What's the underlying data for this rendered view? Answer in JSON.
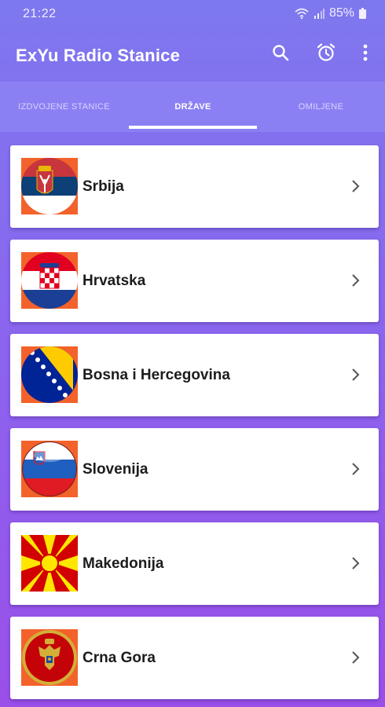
{
  "status_bar": {
    "time": "21:22",
    "battery": "85%"
  },
  "app_bar": {
    "title": "ExYu Radio Stanice",
    "actions": [
      "search-icon",
      "alarm-clock-icon",
      "more-vert-icon"
    ]
  },
  "tabs": [
    {
      "label": "IZDVOJENE STANICE",
      "active": false
    },
    {
      "label": "DRŽAVE",
      "active": true
    },
    {
      "label": "OMILJENE",
      "active": false
    }
  ],
  "countries": [
    {
      "name": "Srbija",
      "flag": "serbia-flag-icon"
    },
    {
      "name": "Hrvatska",
      "flag": "croatia-flag-icon"
    },
    {
      "name": "Bosna i Hercegovina",
      "flag": "bosnia-flag-icon"
    },
    {
      "name": "Slovenija",
      "flag": "slovenia-flag-icon"
    },
    {
      "name": "Makedonija",
      "flag": "macedonia-flag-icon"
    },
    {
      "name": "Crna Gora",
      "flag": "montenegro-flag-icon"
    }
  ],
  "colors": {
    "accent": "#8b80f3",
    "flag_background": "#f2622a"
  }
}
